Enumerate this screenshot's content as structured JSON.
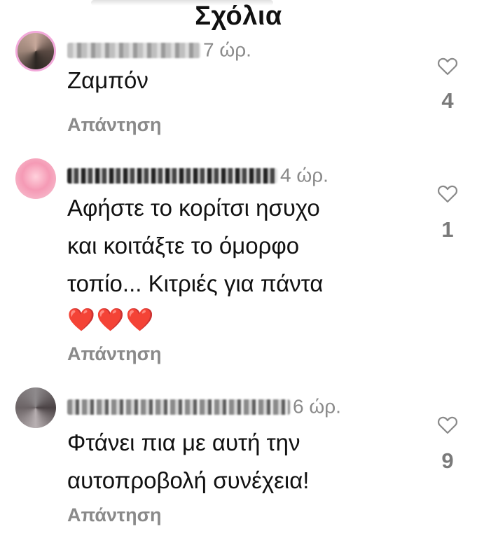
{
  "header": {
    "title": "Σχόλια"
  },
  "comments": [
    {
      "time": "7 ώρ.",
      "text_lines": [
        "Ζαμπόν"
      ],
      "hearts": "",
      "reply_label": "Απάντηση",
      "likes": "4"
    },
    {
      "time": "4 ώρ.",
      "text_lines": [
        "Αφήστε το κορίτσι ησυχο",
        "και κοιτάξτε το όμορφο",
        "τοπίο... Κιτριές για πάντα"
      ],
      "hearts": "❤️❤️❤️",
      "reply_label": "Απάντηση",
      "likes": "1"
    },
    {
      "time": "6 ώρ.",
      "text_lines": [
        "Φτάνει πια με αυτή την",
        "αυτοπροβολή συνέχεια!"
      ],
      "hearts": "",
      "reply_label": "Απάντηση",
      "likes": "9"
    }
  ],
  "icons": {
    "like": "heart-outline-icon",
    "heart_emoji_color": "#e0202e"
  }
}
